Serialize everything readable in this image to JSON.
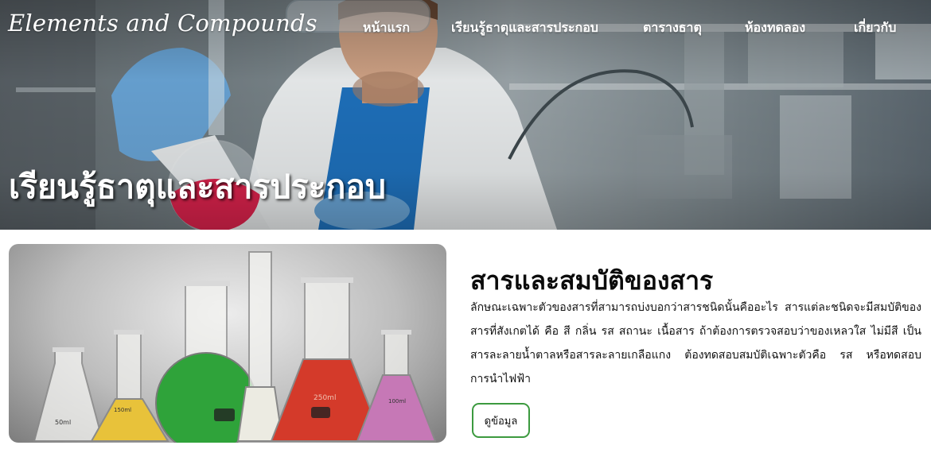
{
  "header": {
    "brand": "Elements and Compounds",
    "nav": [
      {
        "label": "หน้าแรก"
      },
      {
        "label": "เรียนรู้ธาตุและสารประกอบ"
      },
      {
        "label": "ตารางธาตุ"
      },
      {
        "label": "ห้องทดลอง"
      },
      {
        "label": "เกี่ยวกับ"
      }
    ]
  },
  "hero": {
    "title": "เรียนรู้ธาตุและสารประกอบ"
  },
  "section": {
    "title": "สารและสมบัติของสาร",
    "description": "ลักษณะเฉพาะตัวของสารที่สามารถบ่งบอกว่าสารชนิดนั้นคืออะไร สารแต่ละชนิดจะมีสมบัติของสารที่สังเกตได้ คือ สี กลิ่น รส สถานะ เนื้อสาร ถ้าต้องการตรวจสอบว่าของเหลวใส ไม่มีสี เป็นสารละลายน้ำตาลหรือสารละลายเกลือแกง ต้องทดสอบสมบัติเฉพาะตัวคือ รส หรือทดสอบการนำไฟฟ้า",
    "button_label": "ดูข้อมูล",
    "flask_labels": [
      "50ml",
      "150ml",
      "250ml",
      "100ml"
    ]
  },
  "colors": {
    "button_border": "#3c9a3f",
    "liquid_yellow": "#e8c23a",
    "liquid_green": "#2fa33a",
    "liquid_red": "#d43a2a",
    "liquid_pink": "#c678b6",
    "hero_flask_liquid": "#e0234e",
    "glove": "#6aa6d8"
  }
}
